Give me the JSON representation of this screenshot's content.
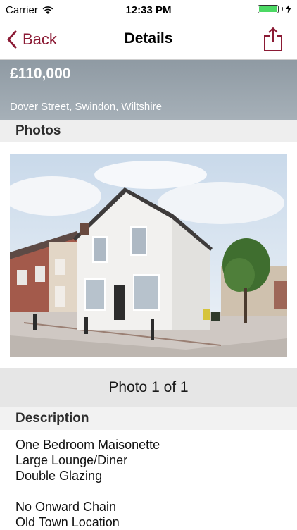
{
  "status_bar": {
    "carrier": "Carrier",
    "time": "12:33 PM"
  },
  "nav": {
    "back_label": "Back",
    "title": "Details",
    "accent_color": "#8b1a34"
  },
  "listing": {
    "price": "£110,000",
    "address": "Dover Street, Swindon, Wiltshire"
  },
  "photos": {
    "section_title": "Photos",
    "counter": "Photo 1 of 1"
  },
  "description": {
    "section_title": "Description",
    "lines_a": [
      "One Bedroom Maisonette",
      "Large Lounge/Diner",
      "Double Glazing"
    ],
    "lines_b": [
      "No Onward Chain",
      "Old Town Location"
    ]
  }
}
